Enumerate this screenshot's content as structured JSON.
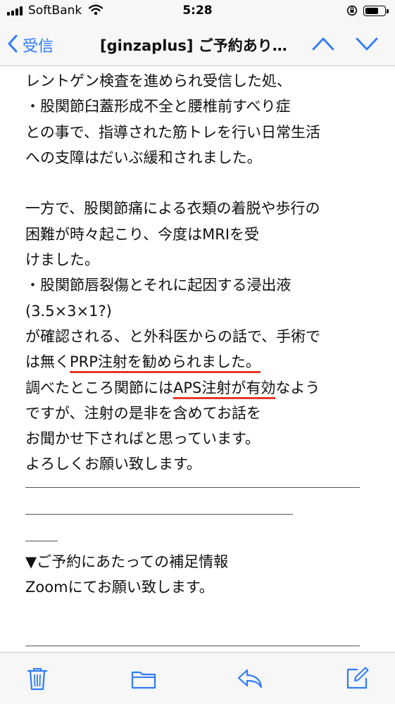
{
  "status_bar": {
    "carrier": "SoftBank",
    "time": "5:28"
  },
  "nav": {
    "back_label": "受信",
    "title": "[ginzaplus] ご予約あり…"
  },
  "mail_body": {
    "lines": [
      "レントゲン検査を進められ受信した処、",
      "・股関節臼蓋形成不全と腰椎前すべり症",
      "との事で、指導された筋トレを行い日常生活",
      "への支障はだいぶ緩和されました。",
      "",
      "一方で、股関節痛による衣類の着脱や歩行の",
      "困難が時々起こり、今度はMRIを受",
      "けました。",
      "・股関節唇裂傷とそれに起因する浸出液",
      "(3.5×3×1?)",
      "が確認される、と外科医からの話で、手術で",
      "は無く",
      "PRP注射を勧められました。",
      "調べたところ関節には",
      "APS注射が有効",
      "なよう",
      "ですが、注射の是非を含めてお話を",
      "お聞かせ下さればと思っています。",
      "よろしくお願い致します。",
      "▼ご予約にあたっての補足情報",
      "Zoomにてお願い致します。"
    ]
  },
  "toolbar": {
    "trash": "trash-icon",
    "folder": "folder-icon",
    "reply": "reply-icon",
    "compose": "compose-icon"
  },
  "colors": {
    "accent": "#2f7cf6",
    "underline": "#e23a2a"
  }
}
